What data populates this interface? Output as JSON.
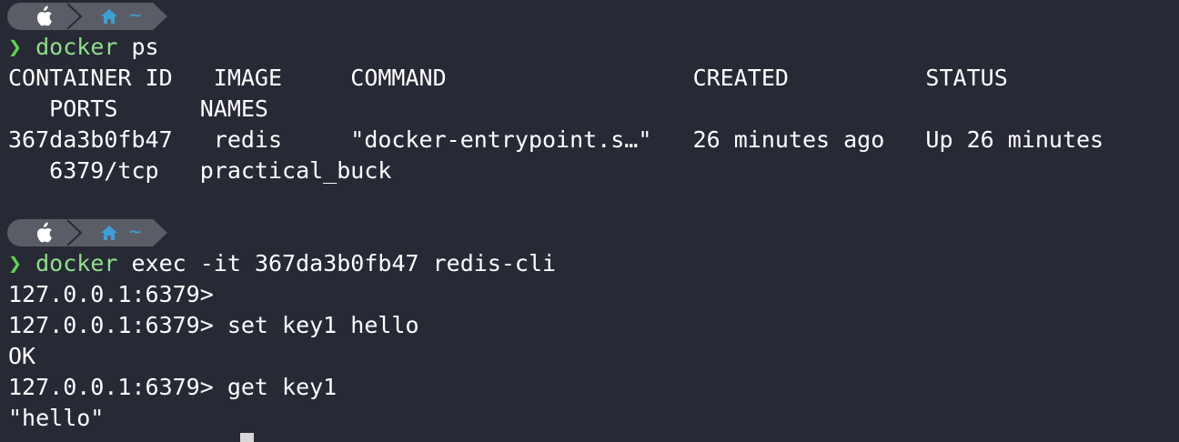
{
  "prompt": {
    "os_icon": "apple-icon",
    "home_icon": "home-icon",
    "path": "~",
    "symbol": "❯",
    "bar_color": "#5b5d66",
    "home_color": "#3b9fd6"
  },
  "lines": {
    "cmd1_program": "docker",
    "cmd1_args": " ps",
    "header_row1": "CONTAINER ID   IMAGE     COMMAND                  CREATED          STATUS",
    "header_row2": "   PORTS      NAMES",
    "data_row1": "367da3b0fb47   redis     \"docker-entrypoint.s…\"   26 minutes ago   Up 26 minutes",
    "data_row2": "   6379/tcp   practical_buck",
    "cmd2_program": "docker",
    "cmd2_args": " exec -it 367da3b0fb47 redis-cli",
    "redis1": "127.0.0.1:6379>",
    "redis2": "127.0.0.1:6379> set key1 hello",
    "redis3": "OK",
    "redis4": "127.0.0.1:6379> get key1",
    "redis5": "\"hello\""
  }
}
